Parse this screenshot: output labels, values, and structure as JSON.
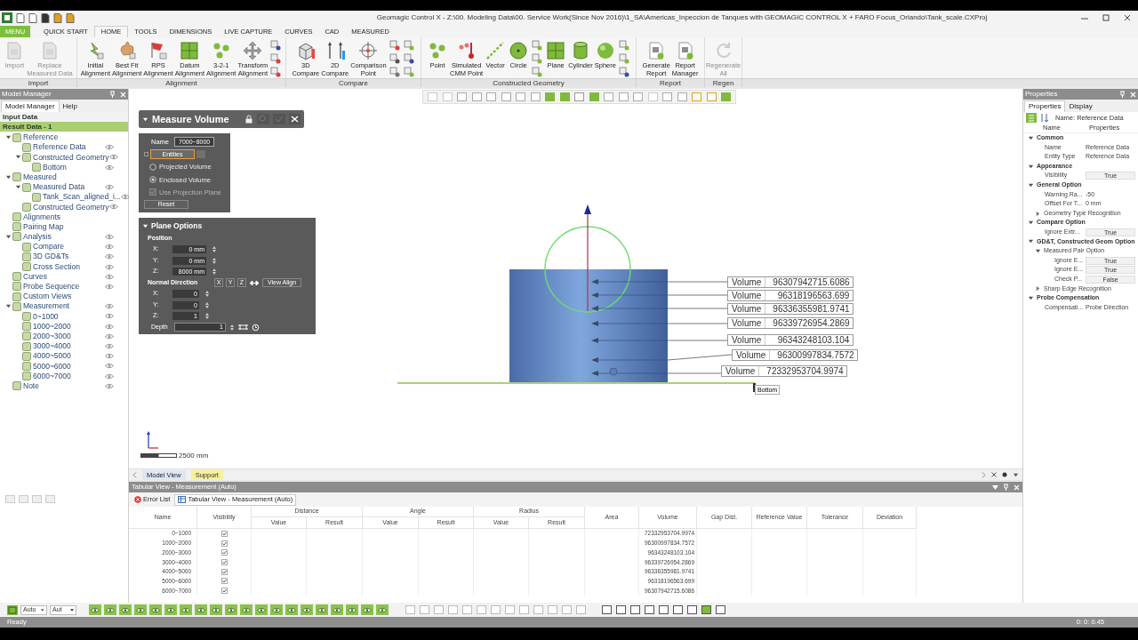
{
  "window": {
    "title": "Geomagic Control X - Z:\\00. Modeling Data\\00. Service Work(Since Nov 2016)\\1_SA\\Americas_Inpeccion de Tanques with GEOMAGIC CONTROL X + FARO Focus_Orlando\\Tank_scale.CXProj"
  },
  "menu_tabs": [
    {
      "label": "MENU",
      "kind": "app",
      "selected": false
    },
    {
      "label": "QUICK START",
      "kind": "tab",
      "selected": false
    },
    {
      "label": "HOME",
      "kind": "tab",
      "selected": true
    },
    {
      "label": "TOOLS",
      "kind": "tab",
      "selected": false
    },
    {
      "label": "DIMENSIONS",
      "kind": "tab",
      "selected": false
    },
    {
      "label": "LIVE CAPTURE",
      "kind": "tab",
      "selected": false
    },
    {
      "label": "CURVES",
      "kind": "tab",
      "selected": false
    },
    {
      "label": "CAD",
      "kind": "tab",
      "selected": false
    },
    {
      "label": "MEASURED",
      "kind": "tab",
      "selected": false
    }
  ],
  "ribbon": [
    {
      "label": "Import",
      "buttons": [
        {
          "label": "Import",
          "disabled": true
        },
        {
          "label": "Replace\nMeasured Data",
          "disabled": true
        }
      ]
    },
    {
      "label": "Alignment",
      "buttons": [
        {
          "label": "Initial\nAlignment",
          "disabled": false
        },
        {
          "label": "Best Fit\nAlignment",
          "disabled": false
        },
        {
          "label": "RPS\nAlignment",
          "disabled": false
        },
        {
          "label": "Datum\nAlignment",
          "disabled": false
        },
        {
          "label": "3-2-1\nAlignment",
          "disabled": false
        },
        {
          "label": "Transform\nAlignment",
          "disabled": false
        }
      ]
    },
    {
      "label": "Compare",
      "buttons": [
        {
          "label": "3D\nCompare",
          "disabled": false
        },
        {
          "label": "2D\nCompare",
          "disabled": false
        },
        {
          "label": "Comparison\nPoint",
          "disabled": false
        }
      ]
    },
    {
      "label": "Constructed Geometry",
      "buttons": [
        {
          "label": "Point",
          "disabled": false
        },
        {
          "label": "Simulated\nCMM Point",
          "disabled": false
        },
        {
          "label": "Vector",
          "disabled": false
        },
        {
          "label": "Circle",
          "disabled": false
        },
        {
          "label": "Plane",
          "disabled": false
        },
        {
          "label": "Cylinder",
          "disabled": false
        },
        {
          "label": "Sphere",
          "disabled": false
        }
      ]
    },
    {
      "label": "Report",
      "buttons": [
        {
          "label": "Generate\nReport",
          "disabled": false
        },
        {
          "label": "Report\nManager",
          "disabled": false
        }
      ]
    },
    {
      "label": "Regen",
      "buttons": [
        {
          "label": "Regenerate\nAll",
          "disabled": true
        }
      ]
    }
  ],
  "model_manager": {
    "title": "Model Manager",
    "tabs": [
      {
        "label": "Model Manager",
        "selected": true
      },
      {
        "label": "Help",
        "selected": false
      }
    ],
    "sections": [
      {
        "label": "Input Data",
        "selected": false
      },
      {
        "label": "Result Data - 1",
        "selected": true
      }
    ],
    "tree": [
      {
        "label": "Reference",
        "eye": false,
        "expanded": true,
        "children": [
          {
            "label": "Reference Data",
            "eye": true
          },
          {
            "label": "Constructed Geometry",
            "eye": true,
            "expanded": true,
            "children": [
              {
                "label": "Bottom",
                "eye": true
              }
            ]
          }
        ]
      },
      {
        "label": "Measured",
        "eye": false,
        "expanded": true,
        "children": [
          {
            "label": "Measured Data",
            "eye": true,
            "expanded": true,
            "children": [
              {
                "label": "Tank_Scan_aligned_i...",
                "eye": true
              }
            ]
          },
          {
            "label": "Constructed Geometry",
            "eye": true
          }
        ]
      },
      {
        "label": "Alignments",
        "eye": false
      },
      {
        "label": "Pairing Map",
        "eye": false
      },
      {
        "label": "Analysis",
        "eye": true,
        "expanded": true,
        "children": [
          {
            "label": "Compare",
            "eye": true
          },
          {
            "label": "3D GD&Ts",
            "eye": true
          },
          {
            "label": "Cross Section",
            "eye": true
          }
        ]
      },
      {
        "label": "Curves",
        "eye": true
      },
      {
        "label": "Probe Sequence",
        "eye": true
      },
      {
        "label": "Custom Views",
        "eye": false
      },
      {
        "label": "Measurement",
        "eye": true,
        "expanded": true,
        "children": [
          {
            "label": "0~1000",
            "eye": true
          },
          {
            "label": "1000~2000",
            "eye": true
          },
          {
            "label": "2000~3000",
            "eye": true
          },
          {
            "label": "3000~4000",
            "eye": true
          },
          {
            "label": "4000~5000",
            "eye": true
          },
          {
            "label": "5000~6000",
            "eye": true
          },
          {
            "label": "6000~7000",
            "eye": true
          }
        ]
      },
      {
        "label": "Note",
        "eye": true
      }
    ]
  },
  "measure_panel": {
    "title": "Measure Volume",
    "name_label": "Name",
    "name_value": "7000~8000",
    "entities": "Entities",
    "options": [
      {
        "label": "Projected Volume",
        "selected": false
      },
      {
        "label": "Enclosed Volume",
        "selected": true
      }
    ],
    "projection": {
      "label": "Use Projection Plane",
      "checked": true,
      "disabled": true
    },
    "reset": "Reset",
    "plane_options": {
      "title": "Plane Options",
      "position_label": "Position",
      "position": [
        {
          "axis": "X:",
          "value": "0 mm"
        },
        {
          "axis": "Y:",
          "value": "0 mm"
        },
        {
          "axis": "Z:",
          "value": "8000 mm"
        }
      ],
      "normal_label": "Normal Direction",
      "axis_buttons": [
        "X",
        "Y",
        "Z"
      ],
      "view_align": "View Align",
      "normal": [
        {
          "axis": "X:",
          "value": "0"
        },
        {
          "axis": "Y:",
          "value": "0"
        },
        {
          "axis": "Z:",
          "value": "1"
        }
      ],
      "depth_label": "Depth",
      "depth": "1"
    }
  },
  "viewport": {
    "callouts": [
      {
        "label": "Volume",
        "value": "96307942715.6086"
      },
      {
        "label": "Volume",
        "value": "96318196563.699"
      },
      {
        "label": "Volume",
        "value": "96336355981.9741"
      },
      {
        "label": "Volume",
        "value": "96339726954.2869"
      },
      {
        "label": "Volume",
        "value": "96343248103.104"
      },
      {
        "label": "Volume",
        "value": "96300997834.7572"
      },
      {
        "label": "Volume",
        "value": "72332953704.9974"
      }
    ],
    "plane_label": "Bottom",
    "scale": "2500 mm",
    "tabs": [
      {
        "label": "Model View",
        "selected": true
      },
      {
        "label": "Support",
        "selected": false
      }
    ]
  },
  "tabular": {
    "title": "Tabular View - Measurement (Auto)",
    "tabs": [
      {
        "label": "Error List",
        "selected": false
      },
      {
        "label": "Tabular View - Measurement (Auto)",
        "selected": true
      }
    ],
    "groups": [
      {
        "label": "Distance",
        "sub": [
          "Value",
          "Result"
        ]
      },
      {
        "label": "Angle",
        "sub": [
          "Value",
          "Result"
        ]
      },
      {
        "label": "Radius",
        "sub": [
          "Value",
          "Result"
        ]
      }
    ],
    "columns": [
      "Name",
      "Visibility",
      "Area",
      "Volume",
      "Gap Dist.",
      "Reference Value",
      "Tolerance",
      "Deviation"
    ],
    "rows": [
      {
        "name": "0~1000",
        "visible": true,
        "volume": "72332953704.9974"
      },
      {
        "name": "1000~2000",
        "visible": true,
        "volume": "96300997834.7572"
      },
      {
        "name": "2000~3000",
        "visible": true,
        "volume": "96343248103.104"
      },
      {
        "name": "3000~4000",
        "visible": true,
        "volume": "96339726954.2869"
      },
      {
        "name": "4000~5000",
        "visible": true,
        "volume": "96336355981.9741"
      },
      {
        "name": "5000~6000",
        "visible": true,
        "volume": "96318196563.699"
      },
      {
        "name": "6000~7000",
        "visible": true,
        "volume": "96307942715.6086"
      }
    ]
  },
  "properties": {
    "title": "Properties",
    "tabs": [
      {
        "label": "Properties",
        "selected": true
      },
      {
        "label": "Display",
        "selected": false
      }
    ],
    "name": "Name: Reference Data",
    "columns": [
      "Name",
      "Properties"
    ],
    "groups": [
      {
        "label": "Common",
        "expanded": true,
        "items": [
          {
            "kind": "text",
            "name": "Name",
            "value": "Reference Data"
          },
          {
            "kind": "text",
            "name": "Entity Type",
            "value": "Reference Data"
          }
        ]
      },
      {
        "label": "Appearance",
        "expanded": true,
        "items": [
          {
            "kind": "field",
            "name": "Visibility",
            "value": "True"
          }
        ]
      },
      {
        "label": "General Option",
        "expanded": true,
        "items": [
          {
            "kind": "text",
            "name": "Warning Ra...",
            "value": "-50"
          },
          {
            "kind": "text",
            "name": "Offset For T...",
            "value": "0 mm"
          },
          {
            "kind": "group",
            "name": "Geometry Type Recognition",
            "expanded": false
          }
        ]
      },
      {
        "label": "Compare Option",
        "expanded": true,
        "items": [
          {
            "kind": "field",
            "name": "Ignore Extr...",
            "value": "True"
          }
        ]
      },
      {
        "label": "GD&T, Constructed Geom Option",
        "expanded": true,
        "items": [
          {
            "kind": "group",
            "name": "Measured Pair Option",
            "expanded": true
          },
          {
            "kind": "field",
            "name": "Ignore E...",
            "value": "True",
            "indent": true
          },
          {
            "kind": "field",
            "name": "Ignore E...",
            "value": "True",
            "indent": true
          },
          {
            "kind": "field",
            "name": "Check P...",
            "value": "False",
            "indent": true
          },
          {
            "kind": "group",
            "name": "Sharp Edge Recognition",
            "expanded": false
          }
        ]
      },
      {
        "label": "Probe Compensation",
        "expanded": true,
        "items": [
          {
            "kind": "text",
            "name": "Compensati...",
            "value": "Probe Direction"
          }
        ]
      }
    ]
  },
  "toolbar": {
    "combos": [
      "Auto",
      "Aut"
    ]
  },
  "status_bar": {
    "text": "Ready",
    "time": "0: 0: 0.45"
  }
}
